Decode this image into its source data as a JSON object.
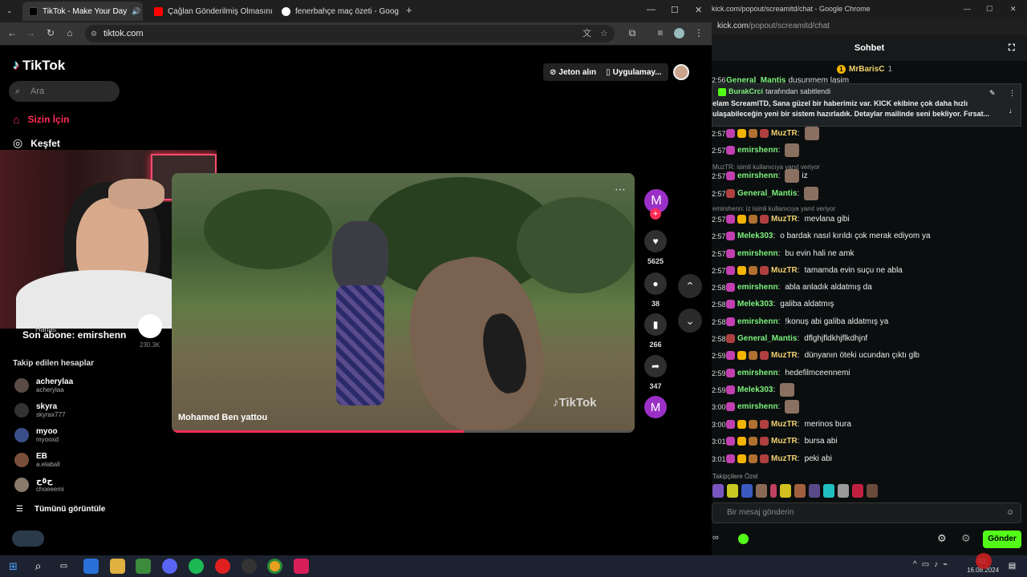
{
  "browser": {
    "tabs": [
      {
        "title": "TikTok - Make Your Day"
      },
      {
        "title": "Çağlan Gönderilmiş Olmasını D"
      },
      {
        "title": "fenerbahçe maç özeti - Google"
      }
    ],
    "url": "tiktok.com"
  },
  "tiktok": {
    "logo": "TikTok",
    "search_placeholder": "Ara",
    "nav": [
      {
        "label": "Sizin İçin"
      },
      {
        "label": "Keşfet"
      }
    ],
    "coins_button": "Jeton alın",
    "app_button": "Uygulamay...",
    "overlay_sub": "Son abone: emirshenn",
    "partial_label": "Hanas",
    "partial_count": "230.3K",
    "following_heading": "Takip edilen hesaplar",
    "following": [
      {
        "name": "acherylaa",
        "user": "acherylaa"
      },
      {
        "name": "skyra",
        "user": "skyrax777"
      },
      {
        "name": "myoo",
        "user": "myooxd"
      },
      {
        "name": "EB",
        "user": "a.elaball"
      },
      {
        "name": "ح٥ح",
        "user": "choeeemi"
      }
    ],
    "see_all": "Tümünü görüntüle",
    "video": {
      "author": "Mohamed Ben yattou",
      "watermark": "TikTok",
      "avatar_letter": "M",
      "likes": "5625",
      "comments": "38",
      "saves": "266",
      "shares": "347",
      "progress": 0.63
    }
  },
  "kick": {
    "window_title": "kick.com/popout/screamitd/chat - Google Chrome",
    "url_host": "kick.com",
    "url_path": "/popout/screamitd/chat",
    "header": "Sohbet",
    "top_gifter": "MrBarisC",
    "top_gifter_count": "1",
    "pinned_by": "BurakCrci",
    "pinned_suffix": "tarafından sabitlendi",
    "pinned_text": "elam ScreamITD, Sana güzel bir haberimiz var. KICK ekibine çok daha hızlı ulaşabileceğin yeni bir sistem hazırladık. Detaylar mailinde seni bekliyor. Fırsat...",
    "partial_top": {
      "time": "2:56",
      "user": "General_Mantis",
      "text": "dusunmem lasim"
    },
    "messages": [
      {
        "time": "2:57",
        "user": "MuzTR",
        "color": "#f0d070",
        "text": "",
        "emote": true
      },
      {
        "time": "2:57",
        "user": "emirshenn",
        "color": "#7cf27c",
        "text": "",
        "emote": true
      },
      {
        "time": "2:57",
        "user": "emirshenn",
        "color": "#7cf27c",
        "text": "iz",
        "emote": true,
        "reply": "MuzTR: isimli kullanıcıya yanıt veriyor"
      },
      {
        "time": "2:57",
        "user": "General_Mantis",
        "color": "#7cf27c",
        "text": "",
        "emote": true
      },
      {
        "time": "2:57",
        "user": "MuzTR",
        "color": "#f0d070",
        "text": "mevlana gibi",
        "emote": false,
        "reply": "emirshenn: iz isimli kullanıcıya yanıt veriyor"
      },
      {
        "time": "2:57",
        "user": "Melek303",
        "color": "#7cf27c",
        "text": "o bardak nasıl kırıldı çok merak ediyom ya",
        "emote": false
      },
      {
        "time": "2:57",
        "user": "emirshenn",
        "color": "#7cf27c",
        "text": "bu evin hali ne amk",
        "emote": false
      },
      {
        "time": "2:57",
        "user": "MuzTR",
        "color": "#f0d070",
        "text": "tamamda evin suçu ne abla",
        "emote": false
      },
      {
        "time": "2:58",
        "user": "emirshenn",
        "color": "#7cf27c",
        "text": "abla anladık aldatmış da",
        "emote": false
      },
      {
        "time": "2:58",
        "user": "Melek303",
        "color": "#7cf27c",
        "text": "galiba aldatmış",
        "emote": false
      },
      {
        "time": "2:58",
        "user": "emirshenn",
        "color": "#7cf27c",
        "text": "!konuş abi galiba aldatmış ya",
        "emote": false
      },
      {
        "time": "2:58",
        "user": "General_Mantis",
        "color": "#7cf27c",
        "text": "dflghjfldkhjflkdhjnf",
        "emote": false
      },
      {
        "time": "2:59",
        "user": "MuzTR",
        "color": "#f0d070",
        "text": "dünyanın öteki ucundan çıktı glb",
        "emote": false
      },
      {
        "time": "2:59",
        "user": "emirshenn",
        "color": "#7cf27c",
        "text": "hedefilmceennemi",
        "emote": false
      },
      {
        "time": "2:59",
        "user": "Melek303",
        "color": "#7cf27c",
        "text": "",
        "emote": true
      },
      {
        "time": "3:00",
        "user": "emirshenn",
        "color": "#7cf27c",
        "text": "",
        "emote": true
      },
      {
        "time": "3:00",
        "user": "MuzTR",
        "color": "#f0d070",
        "text": "merinos bura",
        "emote": false
      },
      {
        "time": "3:01",
        "user": "MuzTR",
        "color": "#f0d070",
        "text": "bursa abi",
        "emote": false
      },
      {
        "time": "3:01",
        "user": "MuzTR",
        "color": "#f0d070",
        "text": "peki abi",
        "emote": false
      }
    ],
    "emote_section": "Takipçilere Özel",
    "input_placeholder": "Bir mesaj gönderin",
    "send_label": "Gönder",
    "accent": "#53fc18"
  },
  "taskbar": {
    "date": "16.08.2024",
    "time": "03:"
  }
}
